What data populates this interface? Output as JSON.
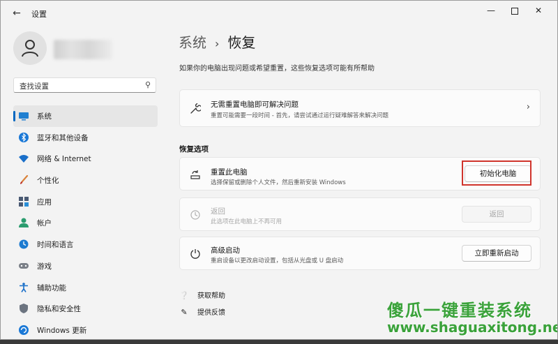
{
  "window": {
    "title": "设置"
  },
  "sidebar": {
    "search_placeholder": "查找设置",
    "items": [
      {
        "label": "系统",
        "icon": "monitor-icon",
        "active": true
      },
      {
        "label": "蓝牙和其他设备",
        "icon": "bluetooth-icon"
      },
      {
        "label": "网络 & Internet",
        "icon": "wifi-icon"
      },
      {
        "label": "个性化",
        "icon": "brush-icon"
      },
      {
        "label": "应用",
        "icon": "apps-icon"
      },
      {
        "label": "帐户",
        "icon": "person-icon"
      },
      {
        "label": "时间和语言",
        "icon": "globe-clock-icon"
      },
      {
        "label": "游戏",
        "icon": "gamepad-icon"
      },
      {
        "label": "辅助功能",
        "icon": "accessibility-icon"
      },
      {
        "label": "隐私和安全性",
        "icon": "shield-icon"
      },
      {
        "label": "Windows 更新",
        "icon": "windows-update-icon"
      }
    ]
  },
  "main": {
    "breadcrumb_parent": "系统",
    "breadcrumb_sep": "›",
    "breadcrumb_current": "恢复",
    "description": "如果你的电脑出现问题或希望重置，这些恢复选项可能有所帮助",
    "troubleshoot": {
      "title": "无需重置电脑即可解决问题",
      "subtitle": "重置可能需要一段时间 - 首先，请尝试通过运行疑难解答来解决问题"
    },
    "section_title": "恢复选项",
    "options": [
      {
        "title": "重置此电脑",
        "subtitle": "选择保留或删除个人文件，然后重新安装 Windows",
        "button": "初始化电脑",
        "enabled": true
      },
      {
        "title": "返回",
        "subtitle": "此选项在此电脑上不再可用",
        "button": "返回",
        "enabled": false
      },
      {
        "title": "高级启动",
        "subtitle": "重启设备以更改启动设置，包括从光盘或 U 盘启动",
        "button": "立即重新启动",
        "enabled": true
      }
    ],
    "links": {
      "help": "获取帮助",
      "feedback": "提供反馈"
    }
  },
  "watermark": {
    "line1": "傻瓜一键重装系统",
    "line2": "www.shaguaxitong.net"
  },
  "colors": {
    "accent": "#0067c0",
    "highlight_box": "#d0342c",
    "watermark": "#3aa23a"
  }
}
